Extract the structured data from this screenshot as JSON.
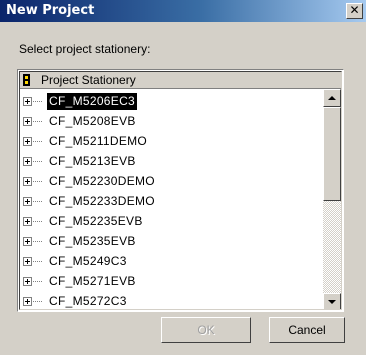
{
  "window": {
    "title": "New Project",
    "close_glyph": "✕"
  },
  "prompt_label": "Select project stationery:",
  "tree": {
    "column_header": "Project Stationery",
    "column_icon": "stationery-icon",
    "items": [
      {
        "label": "CF_M5206EC3",
        "selected": true
      },
      {
        "label": "CF_M5208EVB",
        "selected": false
      },
      {
        "label": "CF_M5211DEMO",
        "selected": false
      },
      {
        "label": "CF_M5213EVB",
        "selected": false
      },
      {
        "label": "CF_M52230DEMO",
        "selected": false
      },
      {
        "label": "CF_M52233DEMO",
        "selected": false
      },
      {
        "label": "CF_M52235EVB",
        "selected": false
      },
      {
        "label": "CF_M5235EVB",
        "selected": false
      },
      {
        "label": "CF_M5249C3",
        "selected": false
      },
      {
        "label": "CF_M5271EVB",
        "selected": false
      },
      {
        "label": "CF_M5272C3",
        "selected": false
      }
    ]
  },
  "buttons": {
    "ok": "OK",
    "cancel": "Cancel"
  },
  "colors": {
    "title_bar_start": "#0a246a",
    "title_bar_end": "#a6caf0",
    "selection_bg": "#000000",
    "dialog_bg": "#d4d0c8"
  }
}
